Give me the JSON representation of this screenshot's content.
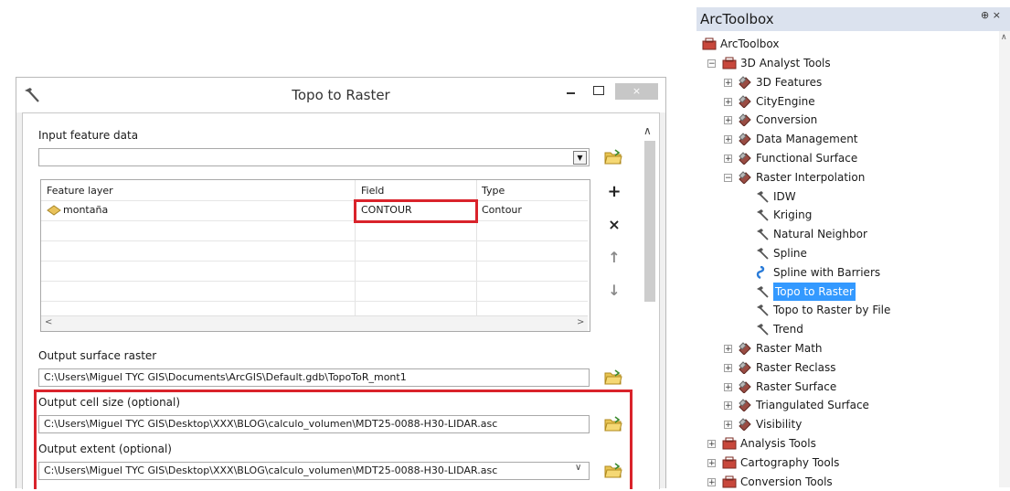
{
  "dialog": {
    "title": "Topo to Raster",
    "close_label": "×",
    "input_feature_label": "Input feature data",
    "input_feature_value": "",
    "table": {
      "headers": [
        "Feature layer",
        "Field",
        "Type"
      ],
      "rows": [
        {
          "layer": "montaña",
          "field": "CONTOUR",
          "type": "Contour"
        }
      ]
    },
    "buttons": {
      "add": "+",
      "remove": "×",
      "up": "↑",
      "down": "↓"
    },
    "scroll_left": "<",
    "scroll_right": ">",
    "output_surface_label": "Output surface raster",
    "output_surface_value": "C:\\Users\\Miguel TYC GIS\\Documents\\ArcGIS\\Default.gdb\\TopoToR_mont1",
    "output_cell_label": "Output cell size (optional)",
    "output_cell_value": "C:\\Users\\Miguel TYC GIS\\Desktop\\XXX\\BLOG\\calculo_volumen\\MDT25-0088-H30-LIDAR.asc",
    "output_extent_label": "Output extent (optional)",
    "output_extent_value": "C:\\Users\\Miguel TYC GIS\\Desktop\\XXX\\BLOG\\calculo_volumen\\MDT25-0088-H30-LIDAR.asc",
    "highlight_color": "#d9232b"
  },
  "toolbox": {
    "title": "ArcToolbox",
    "pin": "⊕ ×",
    "root": "ArcToolbox",
    "items": [
      {
        "label": "3D Analyst Tools",
        "kind": "toolbox",
        "expander": "−"
      },
      {
        "label": "3D Features",
        "kind": "toolset",
        "expander": "+"
      },
      {
        "label": "CityEngine",
        "kind": "toolset",
        "expander": "+"
      },
      {
        "label": "Conversion",
        "kind": "toolset",
        "expander": "+"
      },
      {
        "label": "Data Management",
        "kind": "toolset",
        "expander": "+"
      },
      {
        "label": "Functional Surface",
        "kind": "toolset",
        "expander": "+"
      },
      {
        "label": "Raster Interpolation",
        "kind": "toolset",
        "expander": "−"
      },
      {
        "label": "IDW",
        "kind": "tool"
      },
      {
        "label": "Kriging",
        "kind": "tool"
      },
      {
        "label": "Natural Neighbor",
        "kind": "tool"
      },
      {
        "label": "Spline",
        "kind": "tool"
      },
      {
        "label": "Spline with Barriers",
        "kind": "script"
      },
      {
        "label": "Topo to Raster",
        "kind": "tool",
        "selected": true
      },
      {
        "label": "Topo to Raster by File",
        "kind": "tool"
      },
      {
        "label": "Trend",
        "kind": "tool"
      },
      {
        "label": "Raster Math",
        "kind": "toolset",
        "expander": "+"
      },
      {
        "label": "Raster Reclass",
        "kind": "toolset",
        "expander": "+"
      },
      {
        "label": "Raster Surface",
        "kind": "toolset",
        "expander": "+"
      },
      {
        "label": "Triangulated Surface",
        "kind": "toolset",
        "expander": "+"
      },
      {
        "label": "Visibility",
        "kind": "toolset",
        "expander": "+"
      },
      {
        "label": "Analysis Tools",
        "kind": "toolbox",
        "expander": "+"
      },
      {
        "label": "Cartography Tools",
        "kind": "toolbox",
        "expander": "+"
      },
      {
        "label": "Conversion Tools",
        "kind": "toolbox",
        "expander": "+"
      }
    ],
    "selection_color": "#3399ff"
  }
}
